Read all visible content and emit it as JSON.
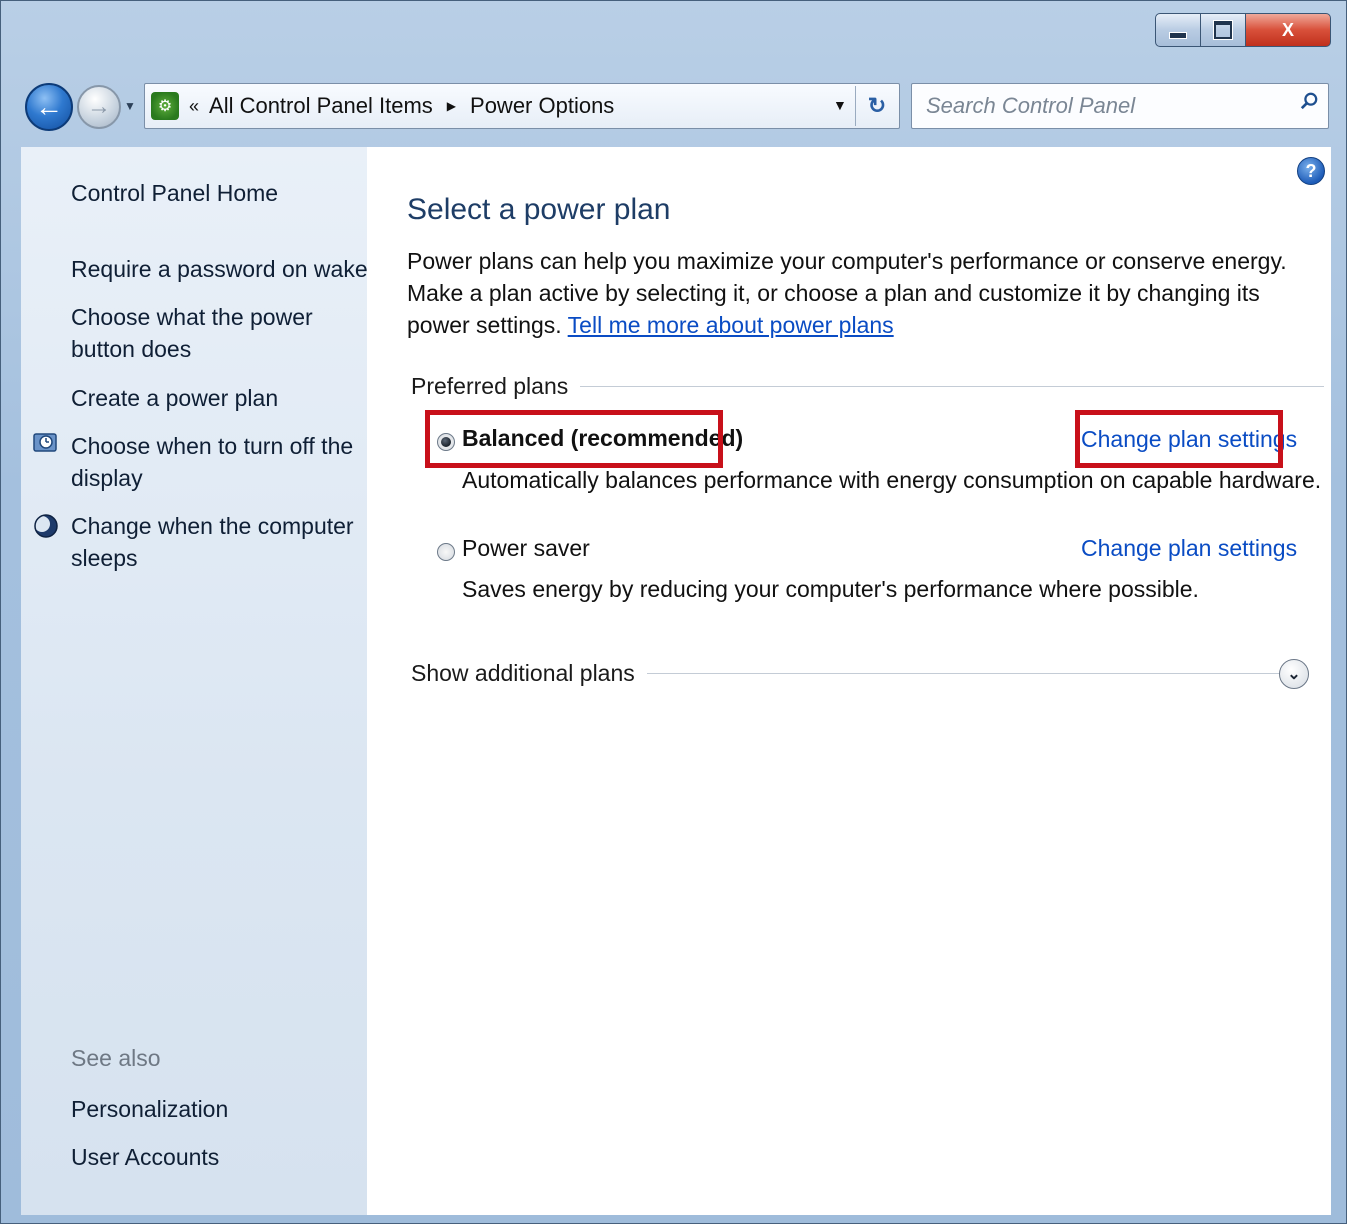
{
  "window": {
    "controls": {
      "minimize": "–",
      "maximize": "□",
      "close": "X"
    }
  },
  "nav": {
    "address_prefix": "«",
    "crumbs": [
      "All Control Panel Items",
      "Power Options"
    ],
    "search_placeholder": "Search Control Panel"
  },
  "sidebar": {
    "home": "Control Panel Home",
    "tasks": [
      {
        "label": "Require a password on wakeup"
      },
      {
        "label": "Choose what the power button does"
      },
      {
        "label": "Create a power plan"
      },
      {
        "label": "Choose when to turn off the display",
        "icon": "display-clock-icon"
      },
      {
        "label": "Change when the computer sleeps",
        "icon": "moon-icon"
      }
    ],
    "see_also": "See also",
    "see_also_links": [
      "Personalization",
      "User Accounts"
    ]
  },
  "main": {
    "help": "?",
    "title": "Select a power plan",
    "intro_text": "Power plans can help you maximize your computer's performance or conserve energy. Make a plan active by selecting it, or choose a plan and customize it by changing its power settings. ",
    "intro_link": "Tell me more about power plans",
    "preferred_heading": "Preferred plans",
    "plans": [
      {
        "name": "Balanced (recommended)",
        "selected": true,
        "description": "Automatically balances performance with energy consumption on capable hardware.",
        "link": "Change plan settings"
      },
      {
        "name": "Power saver",
        "selected": false,
        "description": "Saves energy by reducing your computer's performance where possible.",
        "link": "Change plan settings"
      }
    ],
    "additional_heading": "Show additional plans"
  },
  "colors": {
    "highlight": "#c8101a",
    "link": "#0a4cc4",
    "title": "#1e3d66"
  }
}
